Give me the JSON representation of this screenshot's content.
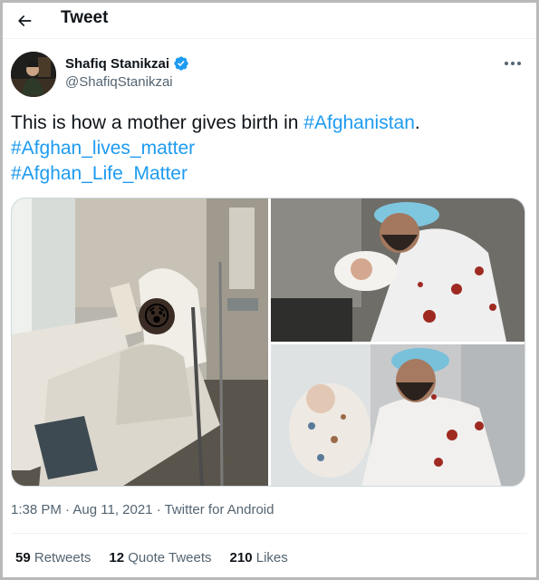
{
  "header": {
    "title": "Tweet",
    "back_icon": "arrow-left-icon"
  },
  "author": {
    "name": "Shafiq Stanikzai",
    "handle": "@ShafiqStanikzai",
    "verified": true,
    "verified_color": "#1d9bf0"
  },
  "tweet": {
    "line1": {
      "text": "This is how a mother gives birth in ",
      "hashtag": "#Afghanistan",
      "suffix": "."
    },
    "line2": {
      "hashtag": "#Afghan_lives_matter"
    },
    "line3": {
      "hashtag": "#Afghan_Life_Matter"
    }
  },
  "media": {
    "count": 3,
    "photos": [
      {
        "subject": "woman-in-hospital-bed-with-crying-emoji",
        "emoji": "😰"
      },
      {
        "subject": "man-in-bloodied-gown-holding-newborn"
      },
      {
        "subject": "man-in-surgical-cap-cradling-baby"
      }
    ]
  },
  "meta": {
    "time": "1:38 PM",
    "sep1": " · ",
    "date": "Aug 11, 2021",
    "sep2": " · ",
    "source": "Twitter for Android"
  },
  "stats": {
    "retweets_count": "59",
    "retweets_label": " Retweets",
    "quotes_count": "12",
    "quotes_label": " Quote Tweets",
    "likes_count": "210",
    "likes_label": " Likes"
  },
  "colors": {
    "link": "#1d9bf0",
    "text": "#0f1419",
    "secondary": "#536471",
    "border": "#cfd9de",
    "frame": "#b9b9b9"
  }
}
